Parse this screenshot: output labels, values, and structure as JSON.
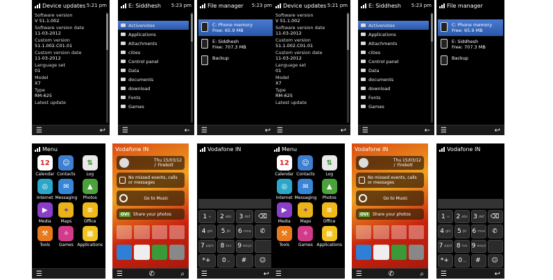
{
  "device_updates": {
    "title": "Device updates",
    "time": "5:21 pm",
    "rows": [
      {
        "label": "Software version",
        "value": "V 51.1.002"
      },
      {
        "label": "Software version date",
        "value": "11-03-2012"
      },
      {
        "label": "Custom version",
        "value": "51.1.002.C01.01"
      },
      {
        "label": "Custom version date",
        "value": "11-03-2012"
      },
      {
        "label": "Language set",
        "value": "01"
      },
      {
        "label": "Model",
        "value": "X7"
      },
      {
        "label": "Type",
        "value": "RM-625"
      },
      {
        "label": "Latest update",
        "value": ""
      }
    ]
  },
  "folder_view": {
    "title": "E: Siddhesh",
    "time": "5:23 pm",
    "items": [
      "Activenotes",
      "Applications",
      "Attachments",
      "cities",
      "Control panel",
      "Data",
      "documents",
      "download",
      "Fonts",
      "Games"
    ]
  },
  "file_manager": {
    "title": "File manager",
    "time": "5:23 pm",
    "items": [
      {
        "name": "C: Phone memory",
        "detail": "Free: 65.9 MB"
      },
      {
        "name": "E: Siddhesh",
        "detail": "Free: 707.3 MB"
      },
      {
        "name": "Backup",
        "detail": ""
      }
    ]
  },
  "menu": {
    "title": "Menu",
    "apps": [
      {
        "label": "Calendar",
        "glyph": "12",
        "color": "#ffffff",
        "fg": "#d21f1f"
      },
      {
        "label": "Contacts",
        "glyph": "☺",
        "color": "#3f7fcf",
        "fg": "#ffffff"
      },
      {
        "label": "Log",
        "glyph": "⇅",
        "color": "#e9e9e9",
        "fg": "#2b8a2b"
      },
      {
        "label": "Internet",
        "glyph": "◎",
        "color": "#2aa7c9",
        "fg": "#ffffff"
      },
      {
        "label": "Messaging",
        "glyph": "✉",
        "color": "#3a86d6",
        "fg": "#ffffff"
      },
      {
        "label": "Photos",
        "glyph": "▲",
        "color": "#4aa33a",
        "fg": "#ffffff"
      },
      {
        "label": "Media",
        "glyph": "▶",
        "color": "#8b3fc9",
        "fg": "#ffffff"
      },
      {
        "label": "Maps",
        "glyph": "⌖",
        "color": "#e8b418",
        "fg": "#7a3bb0"
      },
      {
        "label": "Office",
        "glyph": "≡",
        "color": "#f0b81b",
        "fg": "#ffffff"
      },
      {
        "label": "Tools",
        "glyph": "⚒",
        "color": "#e67a1c",
        "fg": "#ffffff"
      },
      {
        "label": "Games",
        "glyph": "✧",
        "color": "#d23a8a",
        "fg": "#ffffff"
      },
      {
        "label": "Applications",
        "glyph": "▦",
        "color": "#f2c21f",
        "fg": "#ffffff"
      }
    ]
  },
  "home": {
    "operator": "Vodafone IN",
    "date": "Thu 15/03/12",
    "profile": "Firebolt",
    "no_events": "No missed events, calls or messages",
    "music": "Go to Music",
    "share": "Share your photos",
    "ovi": "OVI"
  },
  "dialer": {
    "operator": "Vodafone IN",
    "keys": [
      {
        "n": "1",
        "s": "∞"
      },
      {
        "n": "2",
        "s": "abc"
      },
      {
        "n": "3",
        "s": "def"
      },
      {
        "n": "⌫",
        "s": ""
      },
      {
        "n": "4",
        "s": "ghi"
      },
      {
        "n": "5",
        "s": "jkl"
      },
      {
        "n": "6",
        "s": "mno"
      },
      {
        "n": "✆",
        "s": ""
      },
      {
        "n": "7",
        "s": "pqrs"
      },
      {
        "n": "8",
        "s": "tuv"
      },
      {
        "n": "9",
        "s": "wxyz"
      },
      {
        "n": "",
        "s": ""
      },
      {
        "n": "*+",
        "s": ""
      },
      {
        "n": "0",
        "s": "␣"
      },
      {
        "n": "#",
        "s": ""
      },
      {
        "n": "☺",
        "s": ""
      }
    ]
  }
}
